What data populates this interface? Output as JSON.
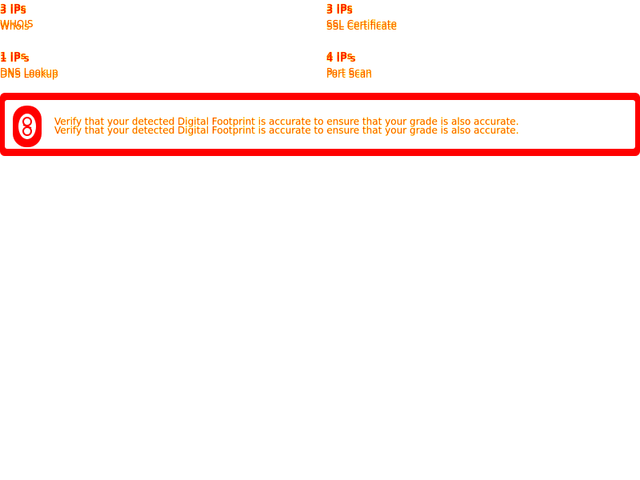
{
  "stats": [
    {
      "id": "whois",
      "ips": "3 IPs",
      "label": "WHOIS",
      "label_ghost": "Whois"
    },
    {
      "id": "ssl",
      "ips": "3 IPs",
      "label": "SSL Certificate",
      "label_ghost": "SSL Certificate"
    },
    {
      "id": "dns",
      "ips": "1 IPs",
      "ips_ghost": "1 IP's",
      "label": "DNS Lookup",
      "label_ghost": "DNS Lookup"
    },
    {
      "id": "port",
      "ips": "4 IPs",
      "ips_ghost": "4 IP's",
      "label": "Port Scan",
      "label_ghost": "Port Scan"
    }
  ],
  "banner": {
    "message": "Verify that your detected Digital Footprint is accurate to ensure that your grade is also accurate.",
    "icon": "footprint-icon"
  },
  "colors": {
    "primary": "#ff0000",
    "outline": "#ffff00",
    "background": "#ffffff"
  }
}
